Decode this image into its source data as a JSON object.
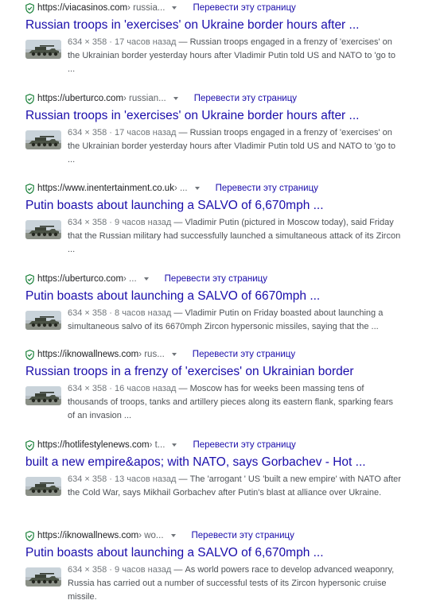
{
  "translate_label": "Перевести эту страницу",
  "results": [
    {
      "url": "https://viacasinos.com",
      "breadcrumb": " › russia...",
      "title": "Russian troops in 'exercises' on Ukraine border hours after ...",
      "meta": "634 × 358 · 17 часов назад",
      "snippet": " — Russian troops engaged in a frenzy of 'exercises' on the Ukrainian border yesterday hours after Vladimir Putin told US and NATO to 'go to ..."
    },
    {
      "url": "https://uberturco.com",
      "breadcrumb": " › russian...",
      "title": "Russian troops in 'exercises' on Ukraine border hours after ...",
      "meta": "634 × 358 · 17 часов назад",
      "snippet": " — Russian troops engaged in a frenzy of 'exercises' on the Ukrainian border yesterday hours after Vladimir Putin told US and NATO to 'go to ..."
    },
    {
      "url": "https://www.inentertainment.co.uk",
      "breadcrumb": " › ...",
      "title": "Putin boasts about launching a SALVO of 6,670mph ...",
      "meta": "634 × 358 · 9 часов назад",
      "snippet": " — Vladimir Putin (pictured in Moscow today), said Friday that the Russian military had successfully launched a simultaneous attack of its Zircon ..."
    },
    {
      "url": "https://uberturco.com",
      "breadcrumb": " › ...",
      "title": "Putin boasts about launching a SALVO of 6670mph ...",
      "meta": "634 × 358 · 8 часов назад",
      "snippet": " — Vladimir Putin on Friday boasted about launching a simultaneous salvo of its 6670mph Zircon hypersonic missiles, saying that the ..."
    },
    {
      "url": "https://iknowallnews.com",
      "breadcrumb": " › rus...",
      "title": "Russian troops in a frenzy of 'exercises' on Ukrainian border",
      "meta": "634 × 358 · 16 часов назад",
      "snippet": " — Moscow has for weeks been massing tens of thousands of troops, tanks and artillery pieces along its eastern flank, sparking fears of an invasion ..."
    },
    {
      "url": "https://hotlifestylenews.com",
      "breadcrumb": " › t...",
      "title": "built a new empire&apos; with NATO, says Gorbachev - Hot ...",
      "meta": "634 × 358 · 13 часов назад",
      "snippet": " — The 'arrogant ' US 'built a new empire' with NATO after the Cold War, says Mikhail Gorbachev after Putin's blast at alliance over Ukraine."
    },
    {
      "url": "https://iknowallnews.com",
      "breadcrumb": " › wo...",
      "title": "Putin boasts about launching a SALVO of 6,670mph ...",
      "meta": "634 × 358 · 9 часов назад",
      "snippet": " — As world powers race to develop advanced weaponry, Russia has carried out a number of successful tests of its Zircon hypersonic cruise missile."
    }
  ]
}
